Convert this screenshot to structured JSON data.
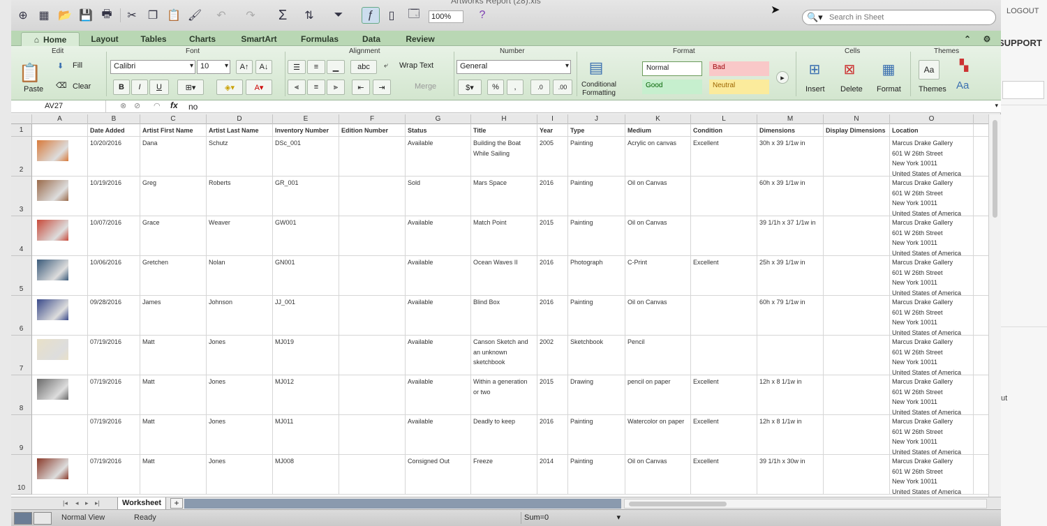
{
  "window": {
    "title": "Artworks Report (28).xls"
  },
  "toolbar": {
    "zoom": "100%",
    "search_placeholder": "Search in Sheet"
  },
  "ribbon_tabs": [
    "Home",
    "Layout",
    "Tables",
    "Charts",
    "SmartArt",
    "Formulas",
    "Data",
    "Review"
  ],
  "ribbon": {
    "groups": {
      "edit": "Edit",
      "font": "Font",
      "alignment": "Alignment",
      "number": "Number",
      "format": "Format",
      "cells": "Cells",
      "themes": "Themes"
    },
    "paste": "Paste",
    "fill": "Fill",
    "clear": "Clear",
    "font_name": "Calibri",
    "font_size": "10",
    "bold": "B",
    "italic": "I",
    "underline": "U",
    "wrap_text": "Wrap Text",
    "abc": "abc",
    "merge": "Merge",
    "number_format": "General",
    "percent": "%",
    "comma": ",",
    "conditional_formatting": "Conditional Formatting",
    "styles": {
      "normal": "Normal",
      "bad": "Bad",
      "good": "Good",
      "neutral": "Neutral"
    },
    "insert": "Insert",
    "delete": "Delete",
    "format": "Format",
    "themes": "Themes",
    "aa": "Aa"
  },
  "formula_bar": {
    "name_box": "AV27",
    "fx": "fx",
    "value": "no"
  },
  "columns": [
    "A",
    "B",
    "C",
    "D",
    "E",
    "F",
    "G",
    "H",
    "I",
    "J",
    "K",
    "L",
    "M",
    "N",
    "O"
  ],
  "headers": [
    "",
    "Date Added",
    "Artist First Name",
    "Artist Last Name",
    "Inventory Number",
    "Edition Number",
    "Status",
    "Title",
    "Year",
    "Type",
    "Medium",
    "Condition",
    "Dimensions",
    "Display Dimensions",
    "Location"
  ],
  "rows": [
    {
      "num": "2",
      "thumb": "#d87a3a",
      "cells": [
        "10/20/2016",
        "Dana",
        "Schutz",
        "DSc_001",
        "",
        "Available",
        "Building the Boat While Sailing",
        "2005",
        "Painting",
        "Acrylic on canvas",
        "Excellent",
        "30h x 39 1/1w in",
        "",
        "Marcus Drake Gallery\n601 W 26th Street\nNew York 10011\nUnited States of America"
      ]
    },
    {
      "num": "3",
      "thumb": "#9a6a4a",
      "cells": [
        "10/19/2016",
        "Greg",
        "Roberts",
        "GR_001",
        "",
        "Sold",
        "Mars Space",
        "2016",
        "Painting",
        "Oil on Canvas",
        "",
        "60h x 39 1/1w in",
        "",
        "Marcus Drake Gallery\n601 W 26th Street\nNew York 10011\nUnited States of America"
      ]
    },
    {
      "num": "4",
      "thumb": "#c84a3a",
      "cells": [
        "10/07/2016",
        "Grace",
        "Weaver",
        "GW001",
        "",
        "Available",
        "Match Point",
        "2015",
        "Painting",
        "Oil on Canvas",
        "",
        "39 1/1h x 37 1/1w in",
        "",
        "Marcus Drake Gallery\n601 W 26th Street\nNew York 10011\nUnited States of America"
      ]
    },
    {
      "num": "5",
      "thumb": "#3a5a7a",
      "cells": [
        "10/06/2016",
        "Gretchen",
        "Nolan",
        "GN001",
        "",
        "Available",
        "Ocean Waves II",
        "2016",
        "Photograph",
        "C-Print",
        "Excellent",
        "25h x 39 1/1w in",
        "",
        "Marcus Drake Gallery\n601 W 26th Street\nNew York 10011\nUnited States of America"
      ]
    },
    {
      "num": "6",
      "thumb": "#3a4a8a",
      "cells": [
        "09/28/2016",
        "James",
        "Johnson",
        "JJ_001",
        "",
        "Available",
        "Blind Box",
        "2016",
        "Painting",
        "Oil on Canvas",
        "",
        "60h x 79 1/1w in",
        "",
        "Marcus Drake Gallery\n601 W 26th Street\nNew York 10011\nUnited States of America"
      ]
    },
    {
      "num": "7",
      "thumb": "#e8e0c8",
      "cells": [
        "07/19/2016",
        "Matt",
        "Jones",
        "MJ019",
        "",
        "Available",
        "Canson Sketch and an unknown sketchbook",
        "2002",
        "Sketchbook",
        "Pencil",
        "",
        "",
        "",
        "Marcus Drake Gallery\n601 W 26th Street\nNew York 10011\nUnited States of America"
      ]
    },
    {
      "num": "8",
      "thumb": "#6a6a6a",
      "cells": [
        "07/19/2016",
        "Matt",
        "Jones",
        "MJ012",
        "",
        "Available",
        "Within a generation or two",
        "2015",
        "Drawing",
        "pencil on paper",
        "Excellent",
        "12h x 8 1/1w in",
        "",
        "Marcus Drake Gallery\n601 W 26th Street\nNew York 10011\nUnited States of America"
      ]
    },
    {
      "num": "9",
      "thumb": "",
      "cells": [
        "07/19/2016",
        "Matt",
        "Jones",
        "MJ011",
        "",
        "Available",
        "Deadly to keep",
        "2016",
        "Painting",
        "Watercolor on paper",
        "Excellent",
        "12h x 8 1/1w in",
        "",
        "Marcus Drake Gallery\n601 W 26th Street\nNew York 10011\nUnited States of America"
      ]
    },
    {
      "num": "10",
      "thumb": "#8a3a2a",
      "cells": [
        "07/19/2016",
        "Matt",
        "Jones",
        "MJ008",
        "",
        "Consigned Out",
        "Freeze",
        "2014",
        "Painting",
        "Oil on Canvas",
        "Excellent",
        "39 1/1h x 30w in",
        "",
        "Marcus Drake Gallery\n601 W 26th Street\nNew York 10011\nUnited States of America"
      ]
    }
  ],
  "sheet_tab": "Worksheet",
  "status": {
    "view": "Normal View",
    "ready": "Ready",
    "sum": "Sum=0"
  },
  "background_page": {
    "logout": "LOGOUT",
    "support": "SUPPORT",
    "ut": "ut"
  }
}
